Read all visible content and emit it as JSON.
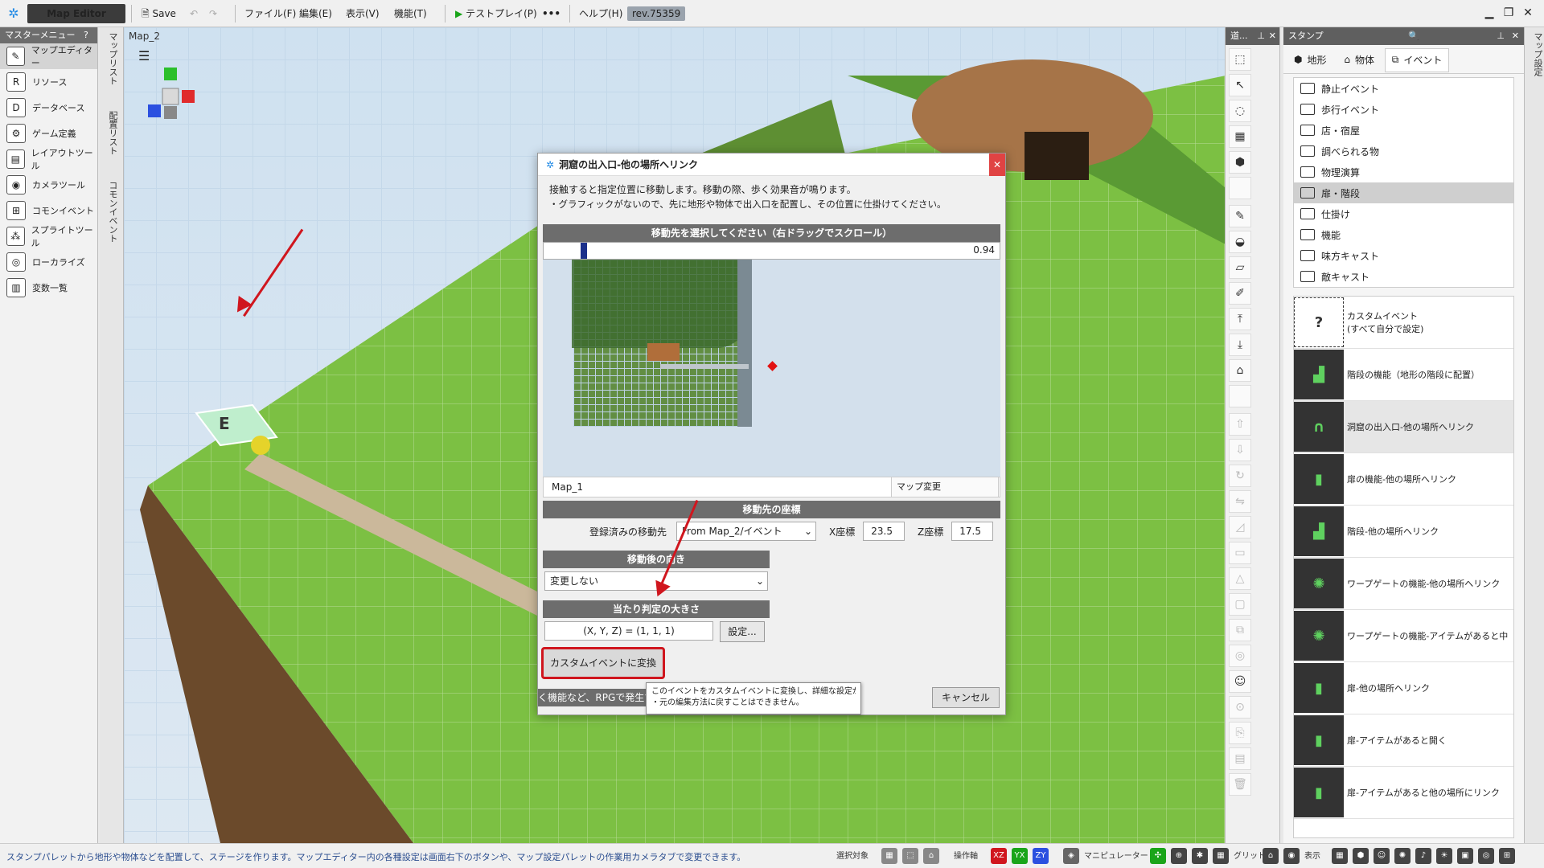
{
  "titlebar": {
    "app_title": "Map Editor",
    "save_label": "Save",
    "menus": [
      "ファイル(F)",
      "編集(E)",
      "表示(V)",
      "機能(T)"
    ],
    "testplay_label": "テストプレイ(P)",
    "more_label": "•••",
    "help_label": "ヘルプ(H)",
    "revision": "rev.75359"
  },
  "left_menu": {
    "header": "マスターメニュー",
    "help": "?",
    "items": [
      {
        "label": "マップエディター",
        "icon": "map-editor-icon"
      },
      {
        "label": "リソース",
        "icon": "resource-icon"
      },
      {
        "label": "データベース",
        "icon": "database-icon"
      },
      {
        "label": "ゲーム定義",
        "icon": "game-definition-icon"
      },
      {
        "label": "レイアウトツール",
        "icon": "layout-tool-icon"
      },
      {
        "label": "カメラツール",
        "icon": "camera-tool-icon"
      },
      {
        "label": "コモンイベント",
        "icon": "common-event-icon"
      },
      {
        "label": "スプライトツール",
        "icon": "sprite-tool-icon"
      },
      {
        "label": "ローカライズ",
        "icon": "localize-icon"
      },
      {
        "label": "変数一覧",
        "icon": "variable-list-icon"
      }
    ]
  },
  "vertical_tabs": [
    "マップリスト",
    "配置リスト",
    "コモンイベント"
  ],
  "viewport": {
    "map_name": "Map_2"
  },
  "tools_panel": {
    "header": "道..."
  },
  "stamp_panel": {
    "header": "スタンプ",
    "tabs": [
      "地形",
      "物体",
      "イベント"
    ],
    "folders": [
      "静止イベント",
      "歩行イベント",
      "店・宿屋",
      "調べられる物",
      "物理演算",
      "扉・階段",
      "仕掛け",
      "機能",
      "味方キャスト",
      "敵キャスト"
    ],
    "selected_folder": "扉・階段",
    "items": [
      "カスタムイベント\n(すべて自分で設定)",
      "階段の機能（地形の階段に配置）",
      "洞窟の出入口-他の場所へリンク",
      "扉の機能-他の場所へリンク",
      "階段-他の場所へリンク",
      "ワープゲートの機能-他の場所へリンク",
      "ワープゲートの機能-アイテムがあると中",
      "扉-他の場所へリンク",
      "扉-アイテムがあると開く",
      "扉-アイテムがあると他の場所にリンク"
    ],
    "selected_item": "洞窟の出入口-他の場所へリンク"
  },
  "far_right_tab": "マップ設定",
  "dialog": {
    "title": "洞窟の出入口-他の場所へリンク",
    "description_line1": "接触すると指定位置に移動します。移動の際、歩く効果音が鳴ります。",
    "description_line2": "・グラフィックがないので、先に地形や物体で出入口を配置し、その位置に仕掛けてください。",
    "destination_header": "移動先を選択してください（右ドラッグでスクロール）",
    "zoom_value": "0.94",
    "map_name": "Map_1",
    "map_change_label": "マップ変更",
    "coords_header": "移動先の座標",
    "registered_dest_label": "登録済みの移動先",
    "registered_dest_value": "From Map_2/イベント",
    "x_label": "X座標",
    "x_value": "23.5",
    "z_label": "Z座標",
    "z_value": "17.5",
    "direction_header": "移動後の向き",
    "direction_value": "変更しない",
    "hitbox_header": "当たり判定の大きさ",
    "hitbox_value": "(X, Y, Z) = (1, 1, 1)",
    "settings_label": "設定...",
    "convert_label": "カスタムイベントに変換",
    "tooltip_line1": "このイベントをカスタムイベントに変換し、詳細な設定ができるようにします。",
    "tooltip_line2": "・元の編集方法に戻すことはできません。",
    "footer_text": "く機能など、RPGで発生す",
    "cancel_label": "キャンセル"
  },
  "statusbar": {
    "message": "スタンプパレットから地形や物体などを配置して、ステージを作ります。マップエディター内の各種設定は画面右下のボタンや、マップ設定パレットの作業用カメラタブで変更できます。",
    "select_target_label": "選択対象",
    "axis_label": "操作軸",
    "axis_buttons": [
      "XZ",
      "YX",
      "ZY"
    ],
    "manipulator_label": "マニピュレーター",
    "grid_label": "グリッド",
    "display_label": "表示"
  },
  "colors": {
    "accent_red": "#d0161e",
    "grass": "#7cc043",
    "dirt": "#6b4a2b",
    "sky": "#cfe1f0"
  }
}
